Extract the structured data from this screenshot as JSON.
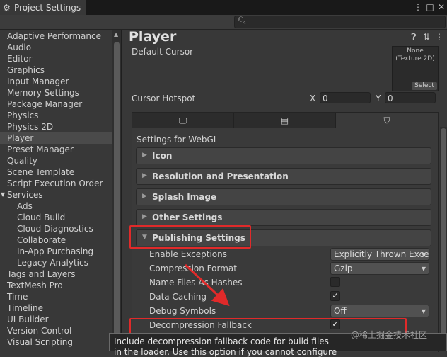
{
  "window": {
    "tab_title": "Project Settings",
    "icons": [
      "gear-icon",
      "more-vertical-icon",
      "maximize-icon",
      "close-icon"
    ]
  },
  "search": {
    "value": "",
    "placeholder": ""
  },
  "sidebar": {
    "selected": "Player",
    "items": [
      {
        "label": "Adaptive Performance",
        "level": 0
      },
      {
        "label": "Audio",
        "level": 0
      },
      {
        "label": "Editor",
        "level": 0
      },
      {
        "label": "Graphics",
        "level": 0
      },
      {
        "label": "Input Manager",
        "level": 0
      },
      {
        "label": "Memory Settings",
        "level": 0
      },
      {
        "label": "Package Manager",
        "level": 0
      },
      {
        "label": "Physics",
        "level": 0
      },
      {
        "label": "Physics 2D",
        "level": 0
      },
      {
        "label": "Player",
        "level": 0
      },
      {
        "label": "Preset Manager",
        "level": 0
      },
      {
        "label": "Quality",
        "level": 0
      },
      {
        "label": "Scene Template",
        "level": 0
      },
      {
        "label": "Script Execution Order",
        "level": 0
      },
      {
        "label": "Services",
        "level": 0
      },
      {
        "label": "Ads",
        "level": 1
      },
      {
        "label": "Cloud Build",
        "level": 1
      },
      {
        "label": "Cloud Diagnostics",
        "level": 1
      },
      {
        "label": "Collaborate",
        "level": 1
      },
      {
        "label": "In-App Purchasing",
        "level": 1
      },
      {
        "label": "Legacy Analytics",
        "level": 1
      },
      {
        "label": "Tags and Layers",
        "level": 0
      },
      {
        "label": "TextMesh Pro",
        "level": 0
      },
      {
        "label": "Time",
        "level": 0
      },
      {
        "label": "Timeline",
        "level": 0
      },
      {
        "label": "UI Builder",
        "level": 0
      },
      {
        "label": "Version Control",
        "level": 0
      },
      {
        "label": "Visual Scripting",
        "level": 0
      }
    ]
  },
  "main": {
    "title": "Player",
    "header_icons": [
      "help-icon",
      "sliders-icon",
      "more-vertical-icon"
    ],
    "default_cursor": {
      "label": "Default Cursor",
      "thumb_line1": "None",
      "thumb_line2": "(Texture 2D)",
      "select_label": "Select"
    },
    "cursor_hotspot": {
      "label": "Cursor Hotspot",
      "x_label": "X",
      "x_value": "0",
      "y_label": "Y",
      "y_value": "0"
    },
    "platform_tabs": [
      {
        "icon": "monitor-icon",
        "active": false
      },
      {
        "icon": "server-icon",
        "active": false
      },
      {
        "icon": "html5-icon",
        "active": true
      }
    ],
    "settings_for": "Settings for WebGL",
    "sections": [
      {
        "label": "Icon",
        "expanded": false
      },
      {
        "label": "Resolution and Presentation",
        "expanded": false
      },
      {
        "label": "Splash Image",
        "expanded": false
      },
      {
        "label": "Other Settings",
        "expanded": false
      },
      {
        "label": "Publishing Settings",
        "expanded": true
      }
    ],
    "publishing": {
      "enable_exceptions": {
        "label": "Enable Exceptions",
        "value": "Explicitly Thrown Exce"
      },
      "compression_format": {
        "label": "Compression Format",
        "value": "Gzip"
      },
      "name_files_as_hashes": {
        "label": "Name Files As Hashes",
        "checked": false
      },
      "data_caching": {
        "label": "Data Caching",
        "checked": true
      },
      "debug_symbols": {
        "label": "Debug Symbols",
        "value": "Off"
      },
      "decompression_fallback": {
        "label": "Decompression Fallback",
        "checked": true
      }
    }
  },
  "tooltip": {
    "line1": "Include decompression fallback code for build files",
    "line2": "in the loader. Use this option if you cannot configure"
  },
  "watermark": "@稀土掘金技术社区",
  "colors": {
    "background": "#383838",
    "selection": "#4a4a4a",
    "annotation_red": "#e02a2a"
  }
}
